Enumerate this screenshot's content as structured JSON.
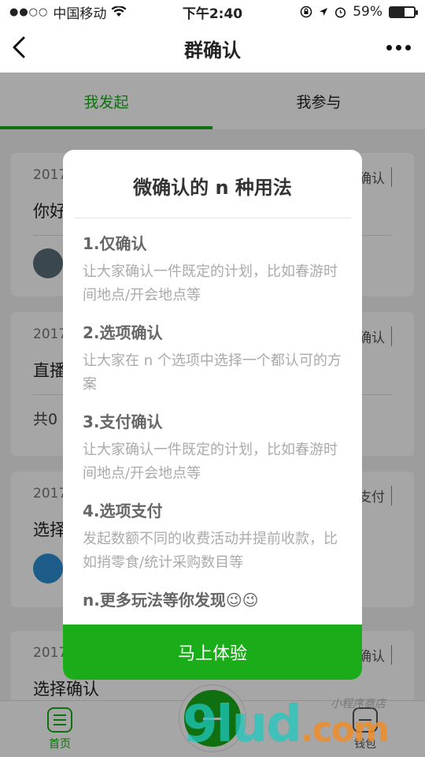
{
  "status_bar": {
    "signal": "●●○○",
    "carrier": "中国移动",
    "time": "下午2:40",
    "battery": "59%",
    "battery_level": 0.59
  },
  "nav": {
    "title": "群确认"
  },
  "tabs": [
    {
      "label": "我发起",
      "active": true
    },
    {
      "label": "我参与",
      "active": false
    }
  ],
  "cards": [
    {
      "date": "2017",
      "tag": "确认",
      "title": "你好",
      "footer": ""
    },
    {
      "date": "2017",
      "tag": "确认",
      "title": "直播",
      "footer": "共0"
    },
    {
      "date": "2017",
      "tag": "支付",
      "title": "选择",
      "footer": ""
    },
    {
      "date": "2017",
      "tag": "确认",
      "title": "选择确认",
      "footer": ""
    }
  ],
  "modal": {
    "title": "微确认的 n 种用法",
    "items": [
      {
        "title": "1.仅确认",
        "desc": "让大家确认一件既定的计划，比如春游时间地点/开会地点等"
      },
      {
        "title": "2.选项确认",
        "desc": "让大家在 n 个选项中选择一个都认可的方案"
      },
      {
        "title": "3.支付确认",
        "desc": "让大家确认一件既定的计划，比如春游时间地点/开会地点等"
      },
      {
        "title": "4.选项支付",
        "desc": "发起数额不同的收费活动并提前收款，比如捎零食/统计采购数目等"
      }
    ],
    "more": "n.更多玩法等你发现😉😉",
    "button_label": "马上体验"
  },
  "tabbar": {
    "home_label": "首页",
    "wallet_label": "钱包"
  },
  "watermark": {
    "main": "9lud",
    "dot": ".com",
    "sub": "小程序商店"
  },
  "colors": {
    "accent": "#1aad19"
  }
}
